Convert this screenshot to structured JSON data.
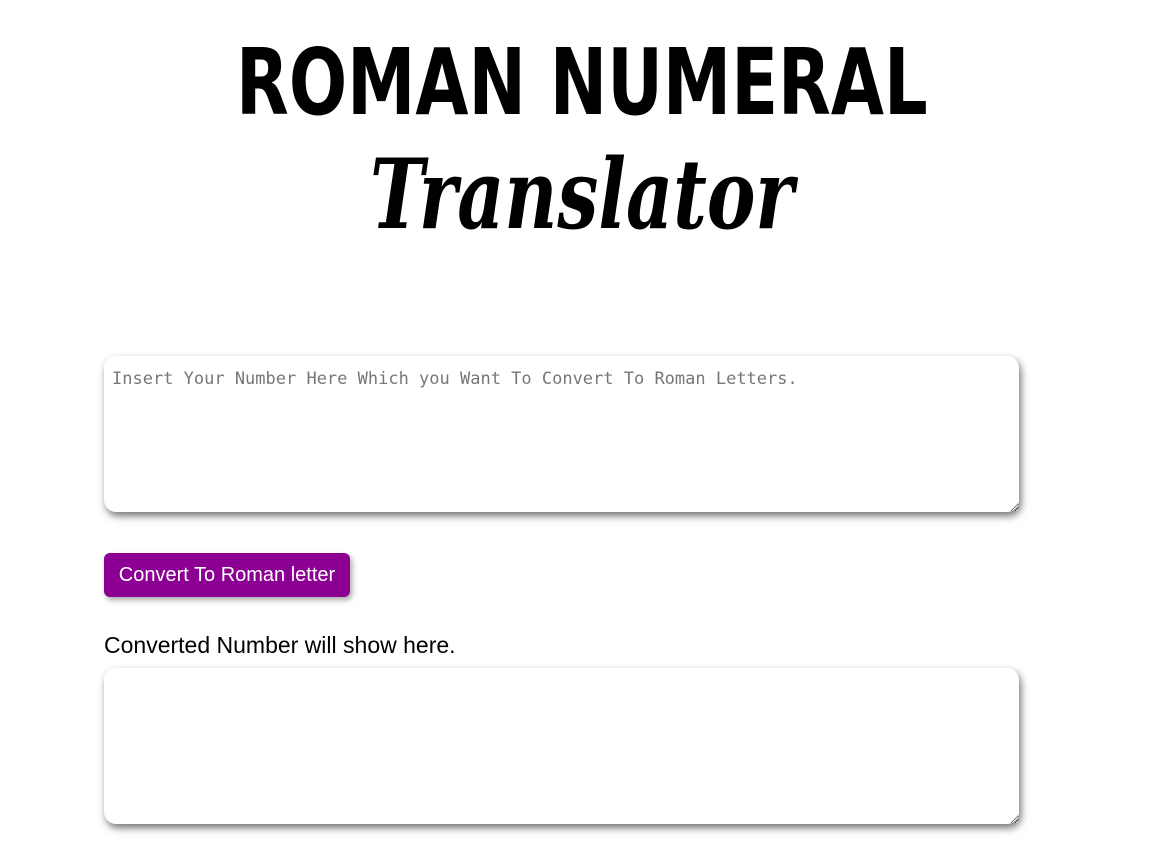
{
  "header": {
    "title": "ROMAN NUMERAL",
    "subtitle": "Translator"
  },
  "input": {
    "placeholder": "Insert Your Number Here Which you Want To Convert To Roman Letters.",
    "value": ""
  },
  "convert_button": {
    "label": "Convert To Roman letter",
    "color": "#8b0093"
  },
  "result": {
    "label": "Converted Number will show here.",
    "value": ""
  }
}
